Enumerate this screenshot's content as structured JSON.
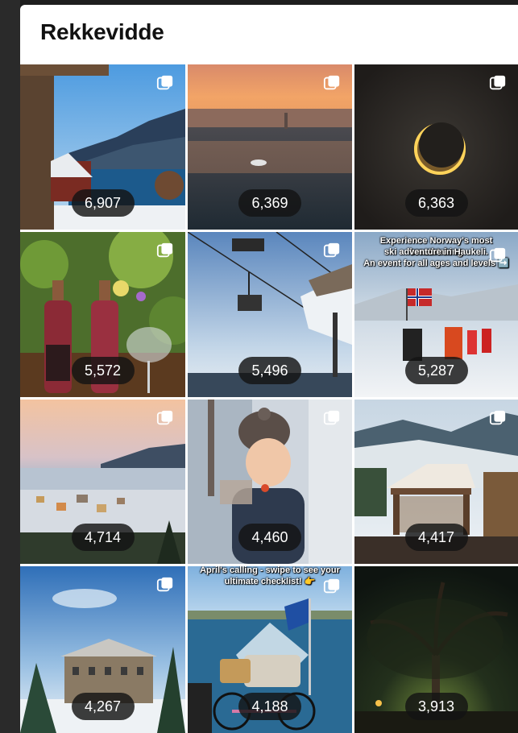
{
  "section": {
    "title": "Rekkevidde"
  },
  "posts": [
    {
      "count": "6,907",
      "carousel": true
    },
    {
      "count": "6,369",
      "carousel": true
    },
    {
      "count": "6,363",
      "carousel": true
    },
    {
      "count": "5,572",
      "carousel": true
    },
    {
      "count": "5,496",
      "carousel": true
    },
    {
      "count": "5,287",
      "carousel": true,
      "overlay_lines": [
        "Experience Norway's most breathtaking",
        "ski adventure in Haukeli.",
        "An event for all ages and levels ➡️"
      ]
    },
    {
      "count": "4,714",
      "carousel": true
    },
    {
      "count": "4,460",
      "carousel": true
    },
    {
      "count": "4,417",
      "carousel": true
    },
    {
      "count": "4,267",
      "carousel": true
    },
    {
      "count": "4,188",
      "carousel": true,
      "overlay_lines": [
        "April's calling - swipe to see your",
        "ultimate checklist! 👉"
      ]
    },
    {
      "count": "3,913",
      "carousel": false
    }
  ],
  "icons": {
    "carousel": "carousel-icon"
  }
}
